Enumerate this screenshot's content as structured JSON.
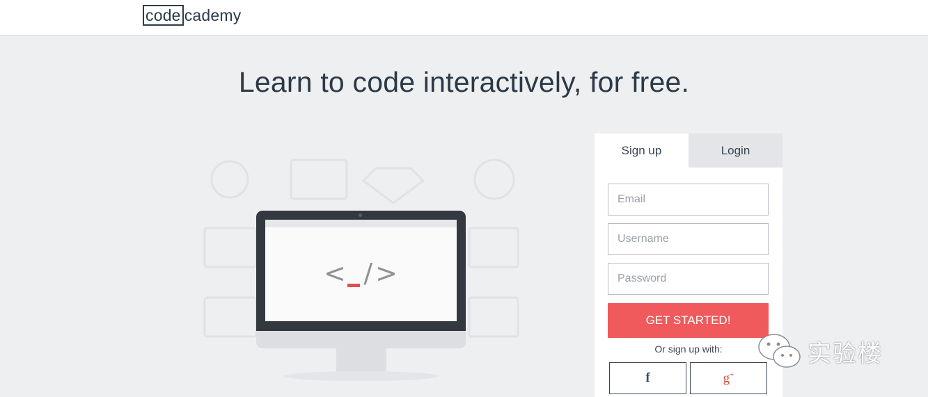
{
  "header": {
    "logo_boxed": "code",
    "logo_rest": "cademy"
  },
  "hero": {
    "headline": "Learn to code interactively, for free."
  },
  "illustration": {
    "screen_glyph_left": "<",
    "screen_glyph_right": "/>",
    "cursor_color": "#e04f52"
  },
  "form": {
    "tabs": [
      {
        "label": "Sign up",
        "active": true
      },
      {
        "label": "Login",
        "active": false
      }
    ],
    "email_placeholder": "Email",
    "username_placeholder": "Username",
    "password_placeholder": "Password",
    "submit_label": "GET STARTED!",
    "submit_color": "#f05a5d",
    "alt_signup_label": "Or sign up with:",
    "social": [
      {
        "name": "facebook-icon",
        "glyph": "f"
      },
      {
        "name": "google-plus-icon",
        "glyph": "g"
      }
    ]
  },
  "watermark": {
    "text": "实验楼"
  },
  "colors": {
    "background": "#eeeff1",
    "accent": "#f05a5d",
    "text_dark": "#2c3947"
  }
}
